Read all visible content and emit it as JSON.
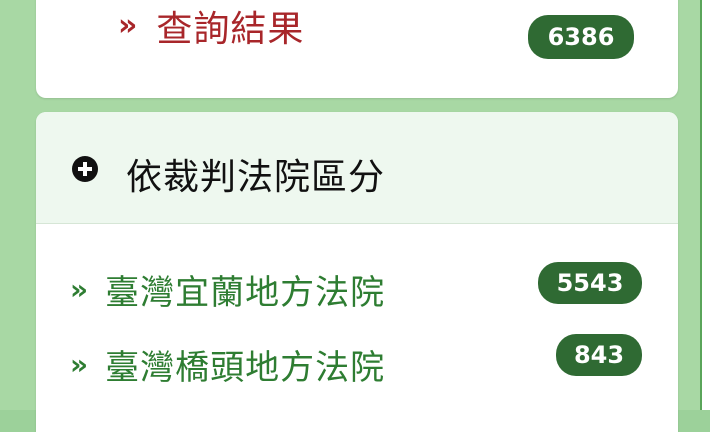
{
  "results": {
    "label": "查詢結果",
    "count": "6386",
    "accent_color": "#a8262a",
    "icon": "double-chevron-right-icon"
  },
  "section": {
    "title": "依裁判法院區分",
    "icon": "plus-circle-icon",
    "courts": [
      {
        "label": "臺灣宜蘭地方法院",
        "count": "5543"
      },
      {
        "label": "臺灣橋頭地方法院",
        "count": "843"
      }
    ]
  },
  "colors": {
    "badge_bg": "#2f6a33",
    "link_green": "#2e7d32",
    "frame_green": "#a8d8a4"
  }
}
